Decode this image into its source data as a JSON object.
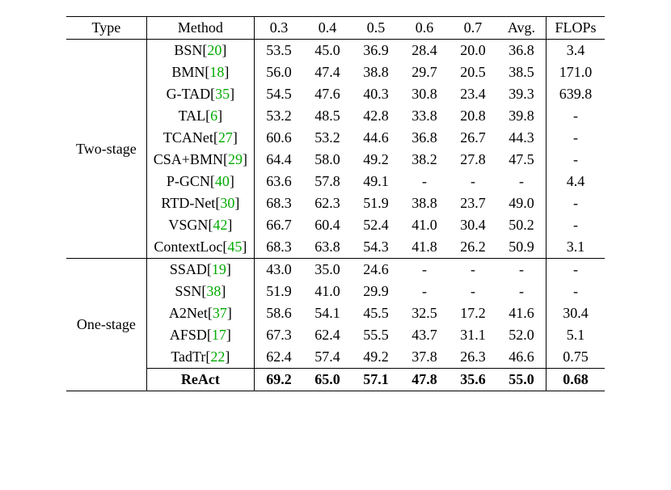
{
  "chart_data": {
    "type": "table",
    "columns": [
      "Type",
      "Method",
      "0.3",
      "0.4",
      "0.5",
      "0.6",
      "0.7",
      "Avg.",
      "FLOPs"
    ],
    "groups": [
      {
        "type": "Two-stage",
        "rows": [
          {
            "method": "BSN",
            "cite": "20",
            "v": [
              "53.5",
              "45.0",
              "36.9",
              "28.4",
              "20.0",
              "36.8",
              "3.4"
            ]
          },
          {
            "method": "BMN",
            "cite": "18",
            "v": [
              "56.0",
              "47.4",
              "38.8",
              "29.7",
              "20.5",
              "38.5",
              "171.0"
            ]
          },
          {
            "method": "G-TAD",
            "cite": "35",
            "v": [
              "54.5",
              "47.6",
              "40.3",
              "30.8",
              "23.4",
              "39.3",
              "639.8"
            ]
          },
          {
            "method": "TAL",
            "cite": "6",
            "v": [
              "53.2",
              "48.5",
              "42.8",
              "33.8",
              "20.8",
              "39.8",
              "-"
            ]
          },
          {
            "method": "TCANet",
            "cite": "27",
            "v": [
              "60.6",
              "53.2",
              "44.6",
              "36.8",
              "26.7",
              "44.3",
              "-"
            ]
          },
          {
            "method": "CSA+BMN",
            "cite": "29",
            "v": [
              "64.4",
              "58.0",
              "49.2",
              "38.2",
              "27.8",
              "47.5",
              "-"
            ]
          },
          {
            "method": "P-GCN",
            "cite": "40",
            "v": [
              "63.6",
              "57.8",
              "49.1",
              "-",
              "-",
              "-",
              "4.4"
            ]
          },
          {
            "method": "RTD-Net",
            "cite": "30",
            "v": [
              "68.3",
              "62.3",
              "51.9",
              "38.8",
              "23.7",
              "49.0",
              "-"
            ]
          },
          {
            "method": "VSGN",
            "cite": "42",
            "v": [
              "66.7",
              "60.4",
              "52.4",
              "41.0",
              "30.4",
              "50.2",
              "-"
            ]
          },
          {
            "method": "ContextLoc",
            "cite": "45",
            "v": [
              "68.3",
              "63.8",
              "54.3",
              "41.8",
              "26.2",
              "50.9",
              "3.1"
            ]
          }
        ]
      },
      {
        "type": "One-stage",
        "rows": [
          {
            "method": "SSAD",
            "cite": "19",
            "v": [
              "43.0",
              "35.0",
              "24.6",
              "-",
              "-",
              "-",
              "-"
            ]
          },
          {
            "method": "SSN",
            "cite": "38",
            "v": [
              "51.9",
              "41.0",
              "29.9",
              "-",
              "-",
              "-",
              "-"
            ]
          },
          {
            "method": "A2Net",
            "cite": "37",
            "v": [
              "58.6",
              "54.1",
              "45.5",
              "32.5",
              "17.2",
              "41.6",
              "30.4"
            ]
          },
          {
            "method": "AFSD",
            "cite": "17",
            "v": [
              "67.3",
              "62.4",
              "55.5",
              "43.7",
              "31.1",
              "52.0",
              "5.1"
            ]
          },
          {
            "method": "TadTr",
            "cite": "22",
            "v": [
              "62.4",
              "57.4",
              "49.2",
              "37.8",
              "26.3",
              "46.6",
              "0.75"
            ]
          }
        ],
        "highlight": {
          "method": "ReAct",
          "cite": "",
          "v": [
            "69.2",
            "65.0",
            "57.1",
            "47.8",
            "35.6",
            "55.0",
            "0.68"
          ]
        }
      }
    ]
  },
  "headers": {
    "type": "Type",
    "method": "Method",
    "c03": "0.3",
    "c04": "0.4",
    "c05": "0.5",
    "c06": "0.6",
    "c07": "0.7",
    "avg": "Avg.",
    "flops": "FLOPs"
  },
  "groups": {
    "twostage": {
      "label": "Two-stage",
      "rows": [
        {
          "name": "BSN",
          "cite": "20",
          "c03": "53.5",
          "c04": "45.0",
          "c05": "36.9",
          "c06": "28.4",
          "c07": "20.0",
          "avg": "36.8",
          "flops": "3.4"
        },
        {
          "name": "BMN",
          "cite": "18",
          "c03": "56.0",
          "c04": "47.4",
          "c05": "38.8",
          "c06": "29.7",
          "c07": "20.5",
          "avg": "38.5",
          "flops": "171.0"
        },
        {
          "name": "G-TAD",
          "cite": "35",
          "c03": "54.5",
          "c04": "47.6",
          "c05": "40.3",
          "c06": "30.8",
          "c07": "23.4",
          "avg": "39.3",
          "flops": "639.8"
        },
        {
          "name": "TAL",
          "cite": "6",
          "c03": "53.2",
          "c04": "48.5",
          "c05": "42.8",
          "c06": "33.8",
          "c07": "20.8",
          "avg": "39.8",
          "flops": "-"
        },
        {
          "name": "TCANet",
          "cite": "27",
          "c03": "60.6",
          "c04": "53.2",
          "c05": "44.6",
          "c06": "36.8",
          "c07": "26.7",
          "avg": "44.3",
          "flops": "-"
        },
        {
          "name": "CSA+BMN",
          "cite": "29",
          "c03": "64.4",
          "c04": "58.0",
          "c05": "49.2",
          "c06": "38.2",
          "c07": "27.8",
          "avg": "47.5",
          "flops": "-"
        },
        {
          "name": "P-GCN",
          "cite": "40",
          "c03": "63.6",
          "c04": "57.8",
          "c05": "49.1",
          "c06": "-",
          "c07": "-",
          "avg": "-",
          "flops": "4.4"
        },
        {
          "name": "RTD-Net",
          "cite": "30",
          "c03": "68.3",
          "c04": "62.3",
          "c05": "51.9",
          "c06": "38.8",
          "c07": "23.7",
          "avg": "49.0",
          "flops": "-"
        },
        {
          "name": "VSGN",
          "cite": "42",
          "c03": "66.7",
          "c04": "60.4",
          "c05": "52.4",
          "c06": "41.0",
          "c07": "30.4",
          "avg": "50.2",
          "flops": "-"
        },
        {
          "name": "ContextLoc",
          "cite": "45",
          "c03": "68.3",
          "c04": "63.8",
          "c05": "54.3",
          "c06": "41.8",
          "c07": "26.2",
          "avg": "50.9",
          "flops": "3.1"
        }
      ]
    },
    "onestage": {
      "label": "One-stage",
      "rows": [
        {
          "name": "SSAD",
          "cite": "19",
          "c03": "43.0",
          "c04": "35.0",
          "c05": "24.6",
          "c06": "-",
          "c07": "-",
          "avg": "-",
          "flops": "-"
        },
        {
          "name": "SSN",
          "cite": "38",
          "c03": "51.9",
          "c04": "41.0",
          "c05": "29.9",
          "c06": "-",
          "c07": "-",
          "avg": "-",
          "flops": "-"
        },
        {
          "name": "A2Net",
          "cite": "37",
          "c03": "58.6",
          "c04": "54.1",
          "c05": "45.5",
          "c06": "32.5",
          "c07": "17.2",
          "avg": "41.6",
          "flops": "30.4"
        },
        {
          "name": "AFSD",
          "cite": "17",
          "c03": "67.3",
          "c04": "62.4",
          "c05": "55.5",
          "c06": "43.7",
          "c07": "31.1",
          "avg": "52.0",
          "flops": "5.1"
        },
        {
          "name": "TadTr",
          "cite": "22",
          "c03": "62.4",
          "c04": "57.4",
          "c05": "49.2",
          "c06": "37.8",
          "c07": "26.3",
          "avg": "46.6",
          "flops": "0.75"
        }
      ],
      "react": {
        "name": "ReAct",
        "c03": "69.2",
        "c04": "65.0",
        "c05": "57.1",
        "c06": "47.8",
        "c07": "35.6",
        "avg": "55.0",
        "flops": "0.68"
      }
    }
  }
}
